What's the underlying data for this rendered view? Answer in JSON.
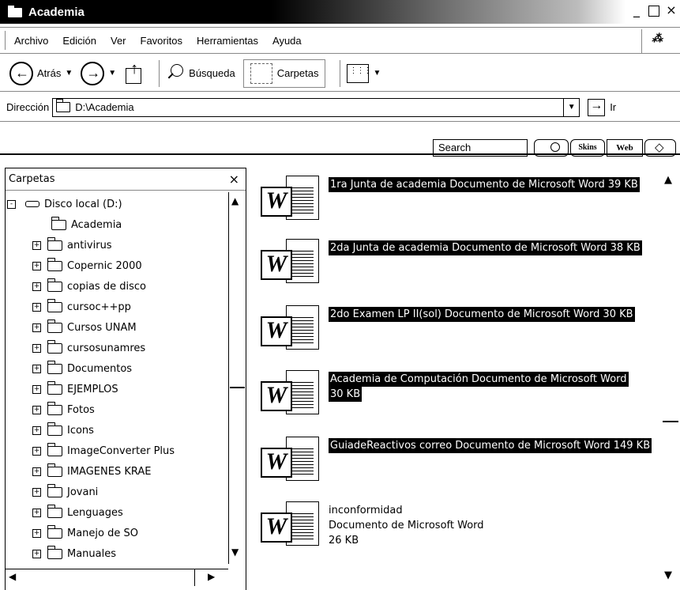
{
  "window": {
    "title": "Academia",
    "minimize": "_",
    "maximize": "",
    "close": "×"
  },
  "menu": {
    "items": [
      "Archivo",
      "Edición",
      "Ver",
      "Favoritos",
      "Herramientas",
      "Ayuda"
    ]
  },
  "toolbar": {
    "back_label": "Atrás",
    "search_label": "Búsqueda",
    "folders_label": "Carpetas"
  },
  "address": {
    "label": "Dirección",
    "value": "D:\\Academia",
    "go_label": "Ir"
  },
  "searchbar": {
    "search_value": "Search",
    "skins_label": "Skins",
    "web_label": "Web"
  },
  "folders_pane": {
    "title": "Carpetas",
    "close": "×",
    "tree": [
      {
        "label": "Disco local (D:)",
        "type": "drive",
        "expander": "-"
      },
      {
        "label": "Academia",
        "type": "folder",
        "expander": ""
      },
      {
        "label": "antivirus",
        "type": "folder",
        "expander": "+"
      },
      {
        "label": "Copernic 2000",
        "type": "folder",
        "expander": "+"
      },
      {
        "label": "copias de disco",
        "type": "folder",
        "expander": "+"
      },
      {
        "label": "cursoc++pp",
        "type": "folder",
        "expander": "+"
      },
      {
        "label": "Cursos UNAM",
        "type": "folder",
        "expander": "+"
      },
      {
        "label": "cursosunamres",
        "type": "folder",
        "expander": "+"
      },
      {
        "label": "Documentos",
        "type": "folder",
        "expander": "+"
      },
      {
        "label": "EJEMPLOS",
        "type": "folder",
        "expander": "+"
      },
      {
        "label": "Fotos",
        "type": "folder",
        "expander": "+"
      },
      {
        "label": "Icons",
        "type": "folder",
        "expander": "+"
      },
      {
        "label": "ImageConverter Plus",
        "type": "folder",
        "expander": "+"
      },
      {
        "label": "IMAGENES KRAE",
        "type": "folder",
        "expander": "+"
      },
      {
        "label": "Jovani",
        "type": "folder",
        "expander": "+"
      },
      {
        "label": "Lenguages",
        "type": "folder",
        "expander": "+"
      },
      {
        "label": "Manejo de SO",
        "type": "folder",
        "expander": "+"
      },
      {
        "label": "Manuales",
        "type": "folder",
        "expander": "+"
      }
    ]
  },
  "files": [
    {
      "name": "1ra Junta de academia",
      "type": "Documento de Microsoft Word",
      "size": "39 KB",
      "selected": true
    },
    {
      "name": "2da Junta de academia",
      "type": "Documento de Microsoft Word",
      "size": "38 KB",
      "selected": true
    },
    {
      "name": "2do Examen LP II(sol)",
      "type": "Documento de Microsoft Word",
      "size": "30 KB",
      "selected": true
    },
    {
      "name": "Academia de Computación",
      "type": "Documento de Microsoft Word",
      "size": "30 KB",
      "selected": true
    },
    {
      "name": "GuiadeReactivos correo",
      "type": "Documento de Microsoft Word",
      "size": "149 KB",
      "selected": true
    },
    {
      "name": "inconformidad",
      "type": "Documento de Microsoft Word",
      "size": "26 KB",
      "selected": false
    }
  ],
  "icons": {
    "word": "W"
  }
}
